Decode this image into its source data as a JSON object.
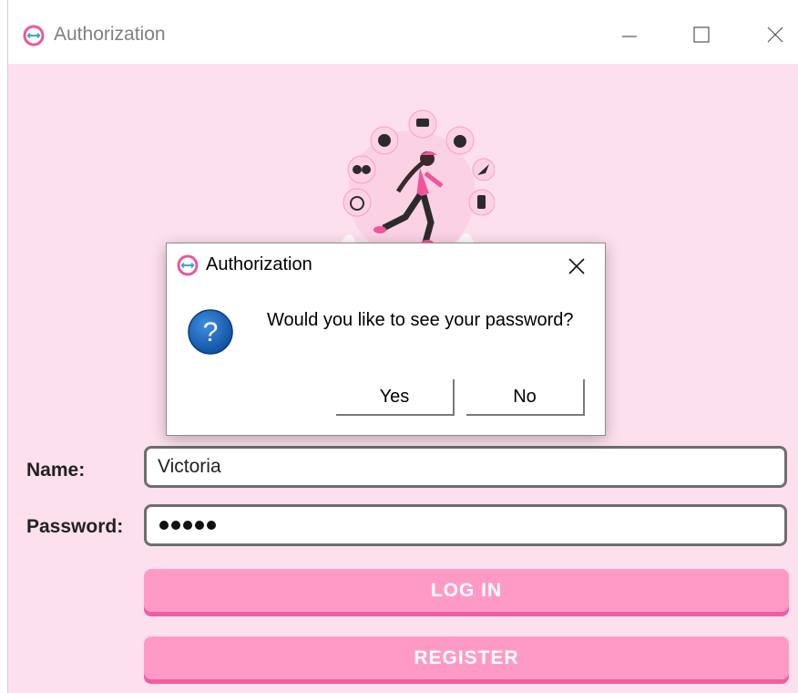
{
  "window": {
    "title": "Authorization",
    "controls": {
      "minimize_icon": "minimize-icon",
      "maximize_icon": "maximize-icon",
      "close_icon": "close-icon"
    }
  },
  "illustration": {
    "description_icon": "running-woman-fitness-illustration"
  },
  "dialog": {
    "title": "Authorization",
    "message": "Would you like to see your password?",
    "icon": "question-icon",
    "yes_label": "Yes",
    "no_label": "No"
  },
  "form": {
    "name_label": "Name:",
    "name_value": "Victoria",
    "password_label": "Password:",
    "password_length": 5,
    "login_label": "LOG IN",
    "register_label": "REGISTER"
  },
  "colors": {
    "background": "#fde0ee",
    "accent": "#ff9ac6",
    "accent_dark": "#f05ea2",
    "icon_ring": "#f0559c",
    "question_blue": "#1a5fb4"
  }
}
